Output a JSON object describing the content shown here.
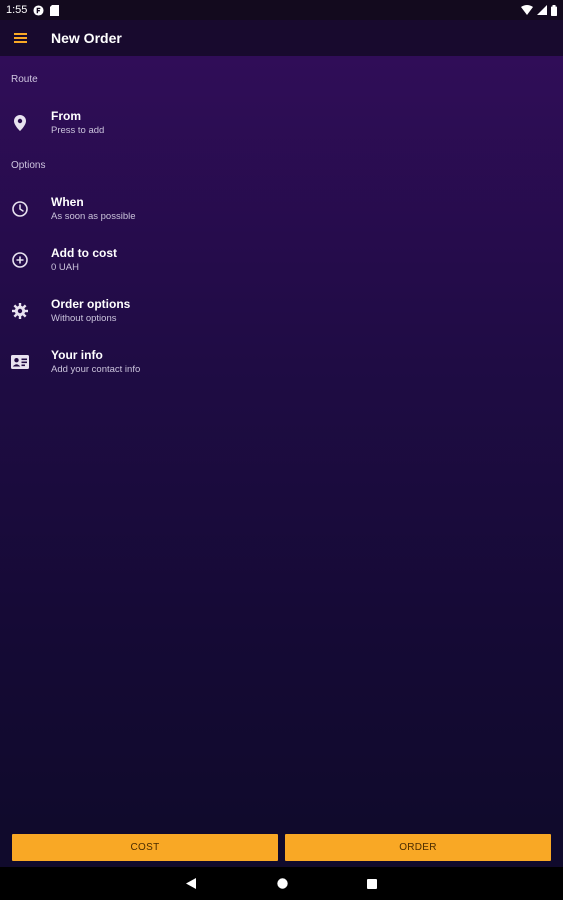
{
  "status_bar": {
    "time": "1:55"
  },
  "app_bar": {
    "title": "New Order",
    "menu_icon": "hamburger-menu-icon",
    "menu_color": "#f9a825"
  },
  "sections": {
    "route": {
      "header": "Route",
      "items": [
        {
          "title": "From",
          "subtitle": "Press to add",
          "icon": "location-pin-icon"
        }
      ]
    },
    "options": {
      "header": "Options",
      "items": [
        {
          "title": "When",
          "subtitle": "As soon as possible",
          "icon": "clock-icon"
        },
        {
          "title": "Add to cost",
          "subtitle": "0 UAH",
          "icon": "add-circle-icon"
        },
        {
          "title": "Order options",
          "subtitle": "Without options",
          "icon": "gear-icon"
        },
        {
          "title": "Your info",
          "subtitle": "Add your contact info",
          "icon": "contact-card-icon"
        }
      ]
    }
  },
  "actions": {
    "cost_label": "COST",
    "order_label": "ORDER",
    "button_color": "#f9a825"
  },
  "colors": {
    "background_top": "#300d58",
    "background_bottom": "#100a2c",
    "accent": "#f9a825"
  }
}
